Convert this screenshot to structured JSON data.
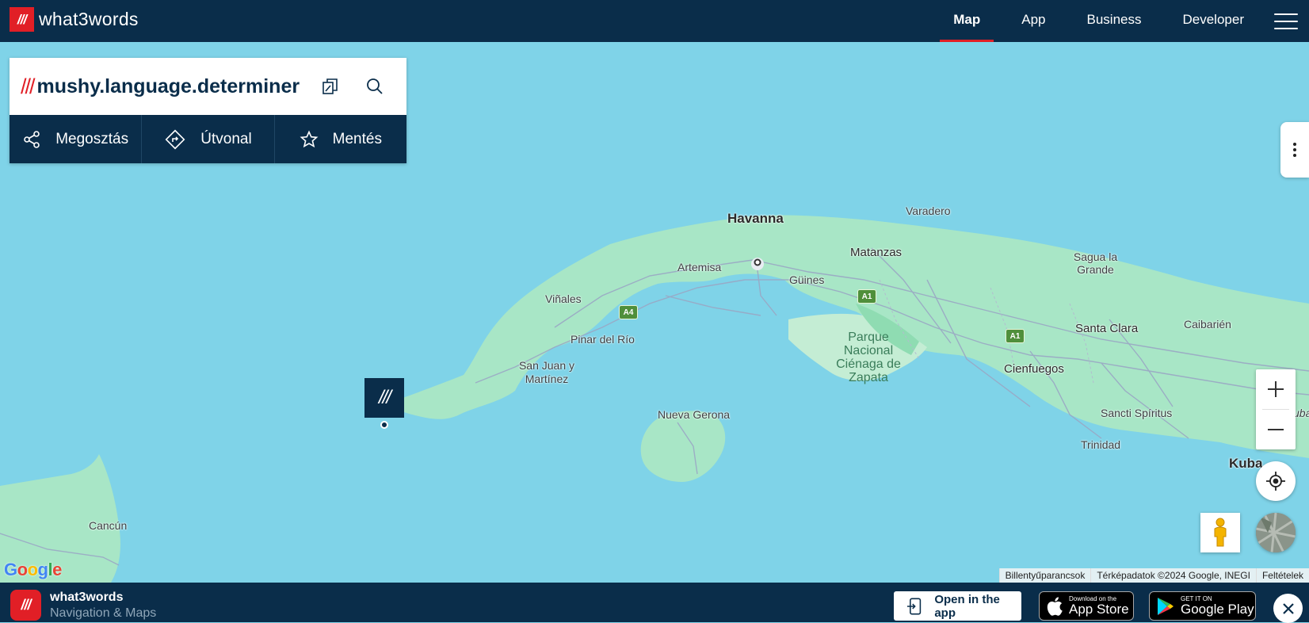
{
  "brand": {
    "logo_slashes": "///",
    "name": "what3words"
  },
  "nav": {
    "items": [
      {
        "label": "Map",
        "active": true
      },
      {
        "label": "App",
        "active": false
      },
      {
        "label": "Business",
        "active": false
      },
      {
        "label": "Developer",
        "active": false
      }
    ],
    "menu_icon": "hamburger-icon"
  },
  "search": {
    "slashes": "///",
    "address": "mushy.language.determiner",
    "copy_icon": "copy-icon",
    "search_icon": "search-icon"
  },
  "actions": [
    {
      "label": "Megosztás",
      "icon": "share-icon"
    },
    {
      "label": "Útvonal",
      "icon": "directions-icon"
    },
    {
      "label": "Mentés",
      "icon": "star-icon"
    }
  ],
  "marker": {
    "label": "///"
  },
  "map": {
    "places": {
      "havanna": "Havanna",
      "varadero": "Varadero",
      "matanzas": "Matanzas",
      "sagua": "Sagua la Grande",
      "artemisa": "Artemisa",
      "guines": "Güines",
      "vinales": "Viñales",
      "pinar": "Pinar del Río",
      "sanjuan": "San Juan y Martínez",
      "parque": "Parque Nacional Ciénaga de Zapata",
      "santaclara": "Santa Clara",
      "caibarien": "Caibarién",
      "cienfuegos": "Cienfuegos",
      "nuevagerona": "Nueva Gerona",
      "sancti": "Sancti Spíritus",
      "trinidad": "Trinidad",
      "kuba": "Kuba",
      "cancun": "Cancún",
      "cuba_edge": "uba"
    },
    "shields": {
      "a4": "A4",
      "a1a": "A1",
      "a1b": "A1"
    },
    "google": [
      "G",
      "o",
      "o",
      "g",
      "l",
      "e"
    ],
    "attribution": {
      "shortcuts": "Billentyűparancsok",
      "data": "Térképadatok ©2024 Google, INEGI",
      "terms": "Feltételek"
    }
  },
  "colors": {
    "navy": "#0a2d4a",
    "red": "#e11f26",
    "water": "#7fd3e8",
    "land": "#a8e6c6"
  },
  "bottom": {
    "app_icon": "///",
    "app_name": "what3words",
    "app_sub": "Navigation & Maps",
    "open_app": "Open in the app",
    "appstore_small": "Download on the",
    "appstore_large": "App Store",
    "play_small": "GET IT ON",
    "play_large": "Google Play"
  }
}
